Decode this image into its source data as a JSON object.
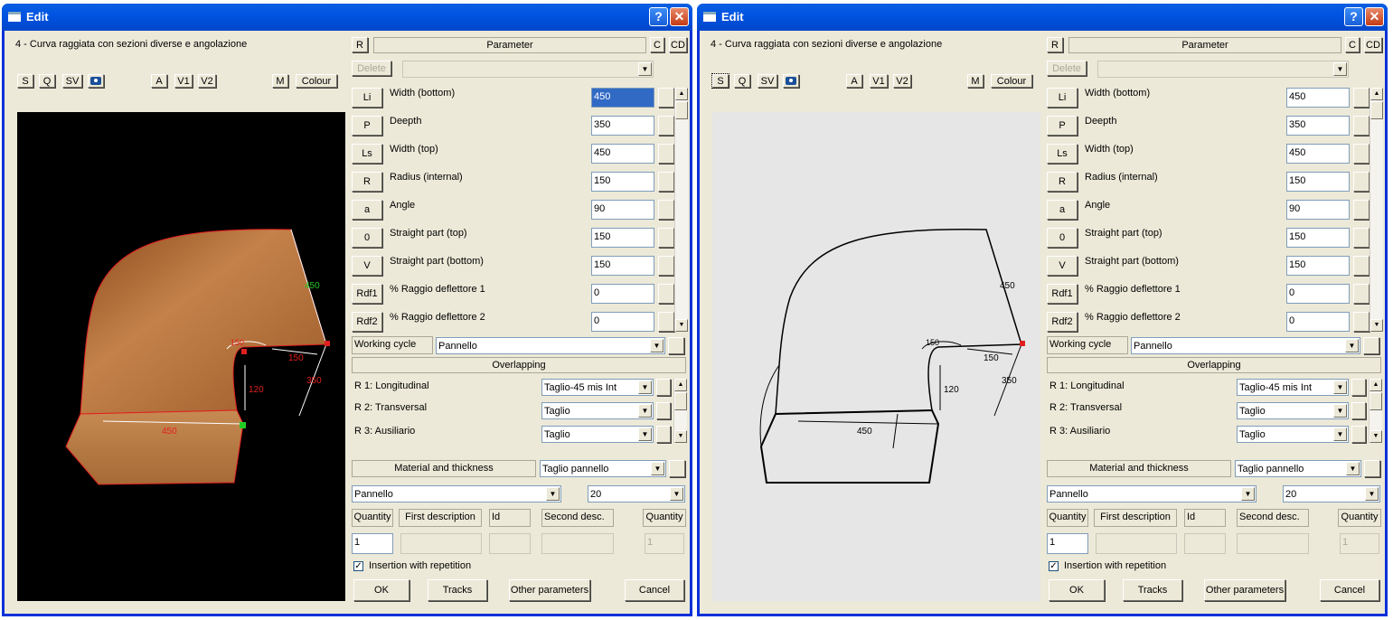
{
  "window_title": "Edit",
  "help_label": "?",
  "close_label": "✕",
  "subtitle": "4 - Curva raggiata con sezioni diverse e angolazione",
  "view_buttons": [
    "S",
    "Q",
    "SV"
  ],
  "camera_icon": "camera-icon",
  "angle_buttons": [
    "A",
    "V1",
    "V2"
  ],
  "m_label": "M",
  "colour_label": "Colour",
  "r_button": "R",
  "parameter_header": "Parameter",
  "c_button": "C",
  "cd_button": "CD",
  "delete_label": "Delete",
  "params": [
    {
      "code": "Li",
      "name": "Width (bottom)",
      "value": "450"
    },
    {
      "code": "P",
      "name": "Deepth",
      "value": "350"
    },
    {
      "code": "Ls",
      "name": "Width (top)",
      "value": "450"
    },
    {
      "code": "R",
      "name": "Radius (internal)",
      "value": "150"
    },
    {
      "code": "a",
      "name": "Angle",
      "value": "90"
    },
    {
      "code": "0",
      "name": "Straight part (top)",
      "value": "150"
    },
    {
      "code": "V",
      "name": "Straight part (bottom)",
      "value": "150"
    },
    {
      "code": "Rdf1",
      "name": "% Raggio deflettore 1",
      "value": "0"
    },
    {
      "code": "Rdf2",
      "name": "% Raggio deflettore 2",
      "value": "0"
    }
  ],
  "working_cycle_label": "Working cycle",
  "working_cycle_value": "Pannello",
  "overlapping_label": "Overlapping",
  "overlap_rows": [
    {
      "label": "R 1: Longitudinal",
      "value": "Taglio-45 mis Int"
    },
    {
      "label": "R 2: Transversal",
      "value": "Taglio"
    },
    {
      "label": "R 3: Ausiliario",
      "value": "Taglio"
    }
  ],
  "material_label": "Material and thickness",
  "material_type": "Taglio pannello",
  "material_value": "Pannello",
  "thickness_value": "20",
  "columns": [
    "Quantity",
    "First description",
    "Id",
    "Second desc.",
    "Quantity"
  ],
  "quantity_value": "1",
  "quantity2_value": "1",
  "insertion_label": "Insertion with repetition",
  "check_mark": "✓",
  "ok_label": "OK",
  "tracks_label": "Tracks",
  "other_label": "Other parameters",
  "cancel_label": "Cancel",
  "dims": [
    "450",
    "150",
    "120",
    "350",
    "450",
    "150"
  ],
  "colors": {
    "title_bar": "#0054e3",
    "face": "#ece9d8",
    "shape": "#b5743a",
    "outline_red": "#e02020",
    "dim_green": "#22cc22"
  }
}
